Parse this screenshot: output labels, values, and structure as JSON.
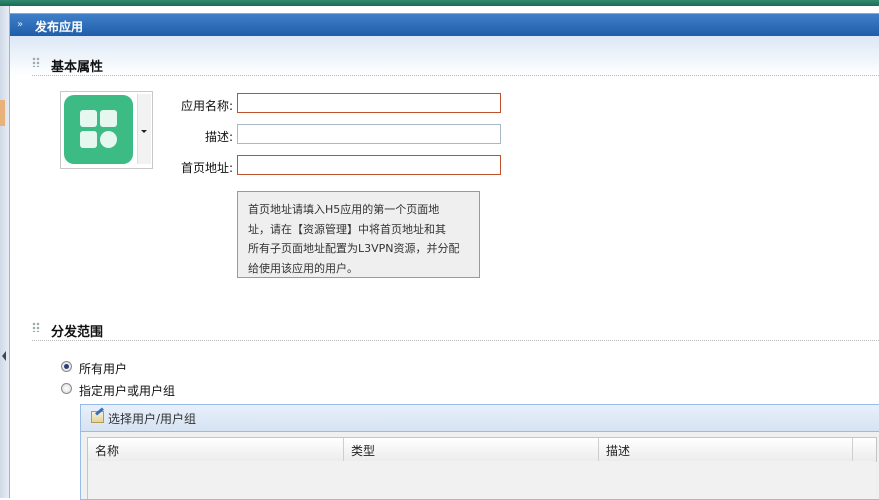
{
  "panel": {
    "title": "发布应用"
  },
  "sections": {
    "basic": "基本属性",
    "distribution": "分发范围"
  },
  "app_icon": {
    "icon": "apps-grid-icon",
    "color": "#3dbb84"
  },
  "form": {
    "name_label": "应用名称:",
    "name_value": "",
    "desc_label": "描述:",
    "desc_value": "",
    "url_label": "首页地址:",
    "url_value": "",
    "tip_lines": [
      "首页地址请填入H5应用的第一个页面地",
      "址，请在【资源管理】中将首页地址和其",
      "所有子页面地址配置为L3VPN资源，并分配",
      "给使用该应用的用户。"
    ]
  },
  "distribution": {
    "options": [
      "所有用户",
      "指定用户或用户组"
    ],
    "selected": "所有用户"
  },
  "grid": {
    "toolbar_button": "选择用户/用户组",
    "columns": [
      "名称",
      "类型",
      "描述"
    ]
  }
}
